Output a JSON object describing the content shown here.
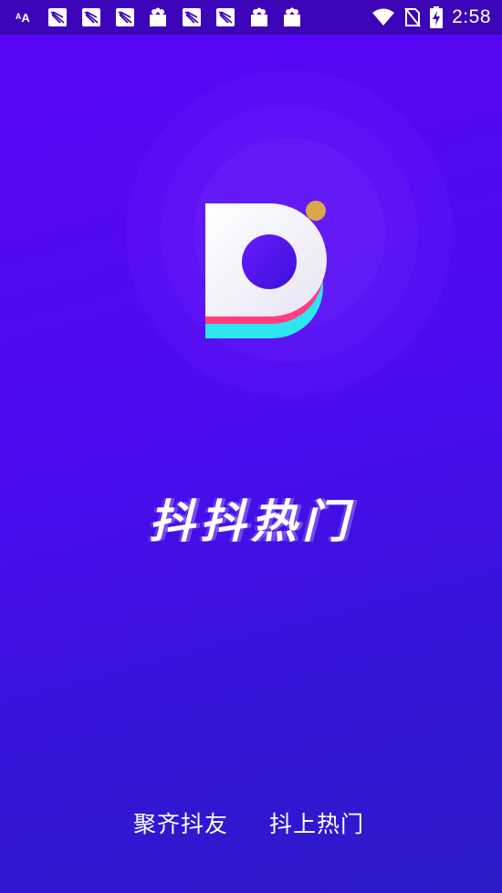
{
  "status_bar": {
    "time": "2:58",
    "notification_icons": [
      "keyboard-icon",
      "kite-icon",
      "kite-icon",
      "kite-icon",
      "bag-icon",
      "kite-icon",
      "kite-icon",
      "bag-icon",
      "bag-icon"
    ],
    "system_icons": [
      "wifi-icon",
      "no-sim-icon",
      "battery-charging-icon"
    ]
  },
  "splash": {
    "app_name": "抖抖热门",
    "slogan_left": "聚齐抖友",
    "slogan_right": "抖上热门"
  },
  "colors": {
    "background_top": "#5a05f7",
    "background_bottom": "#2a1cc7",
    "status_bar": "#3d05b8",
    "logo_pink": "#ff3d7f",
    "logo_cyan": "#2ee6f0",
    "logo_dot": "#d9a84a"
  }
}
